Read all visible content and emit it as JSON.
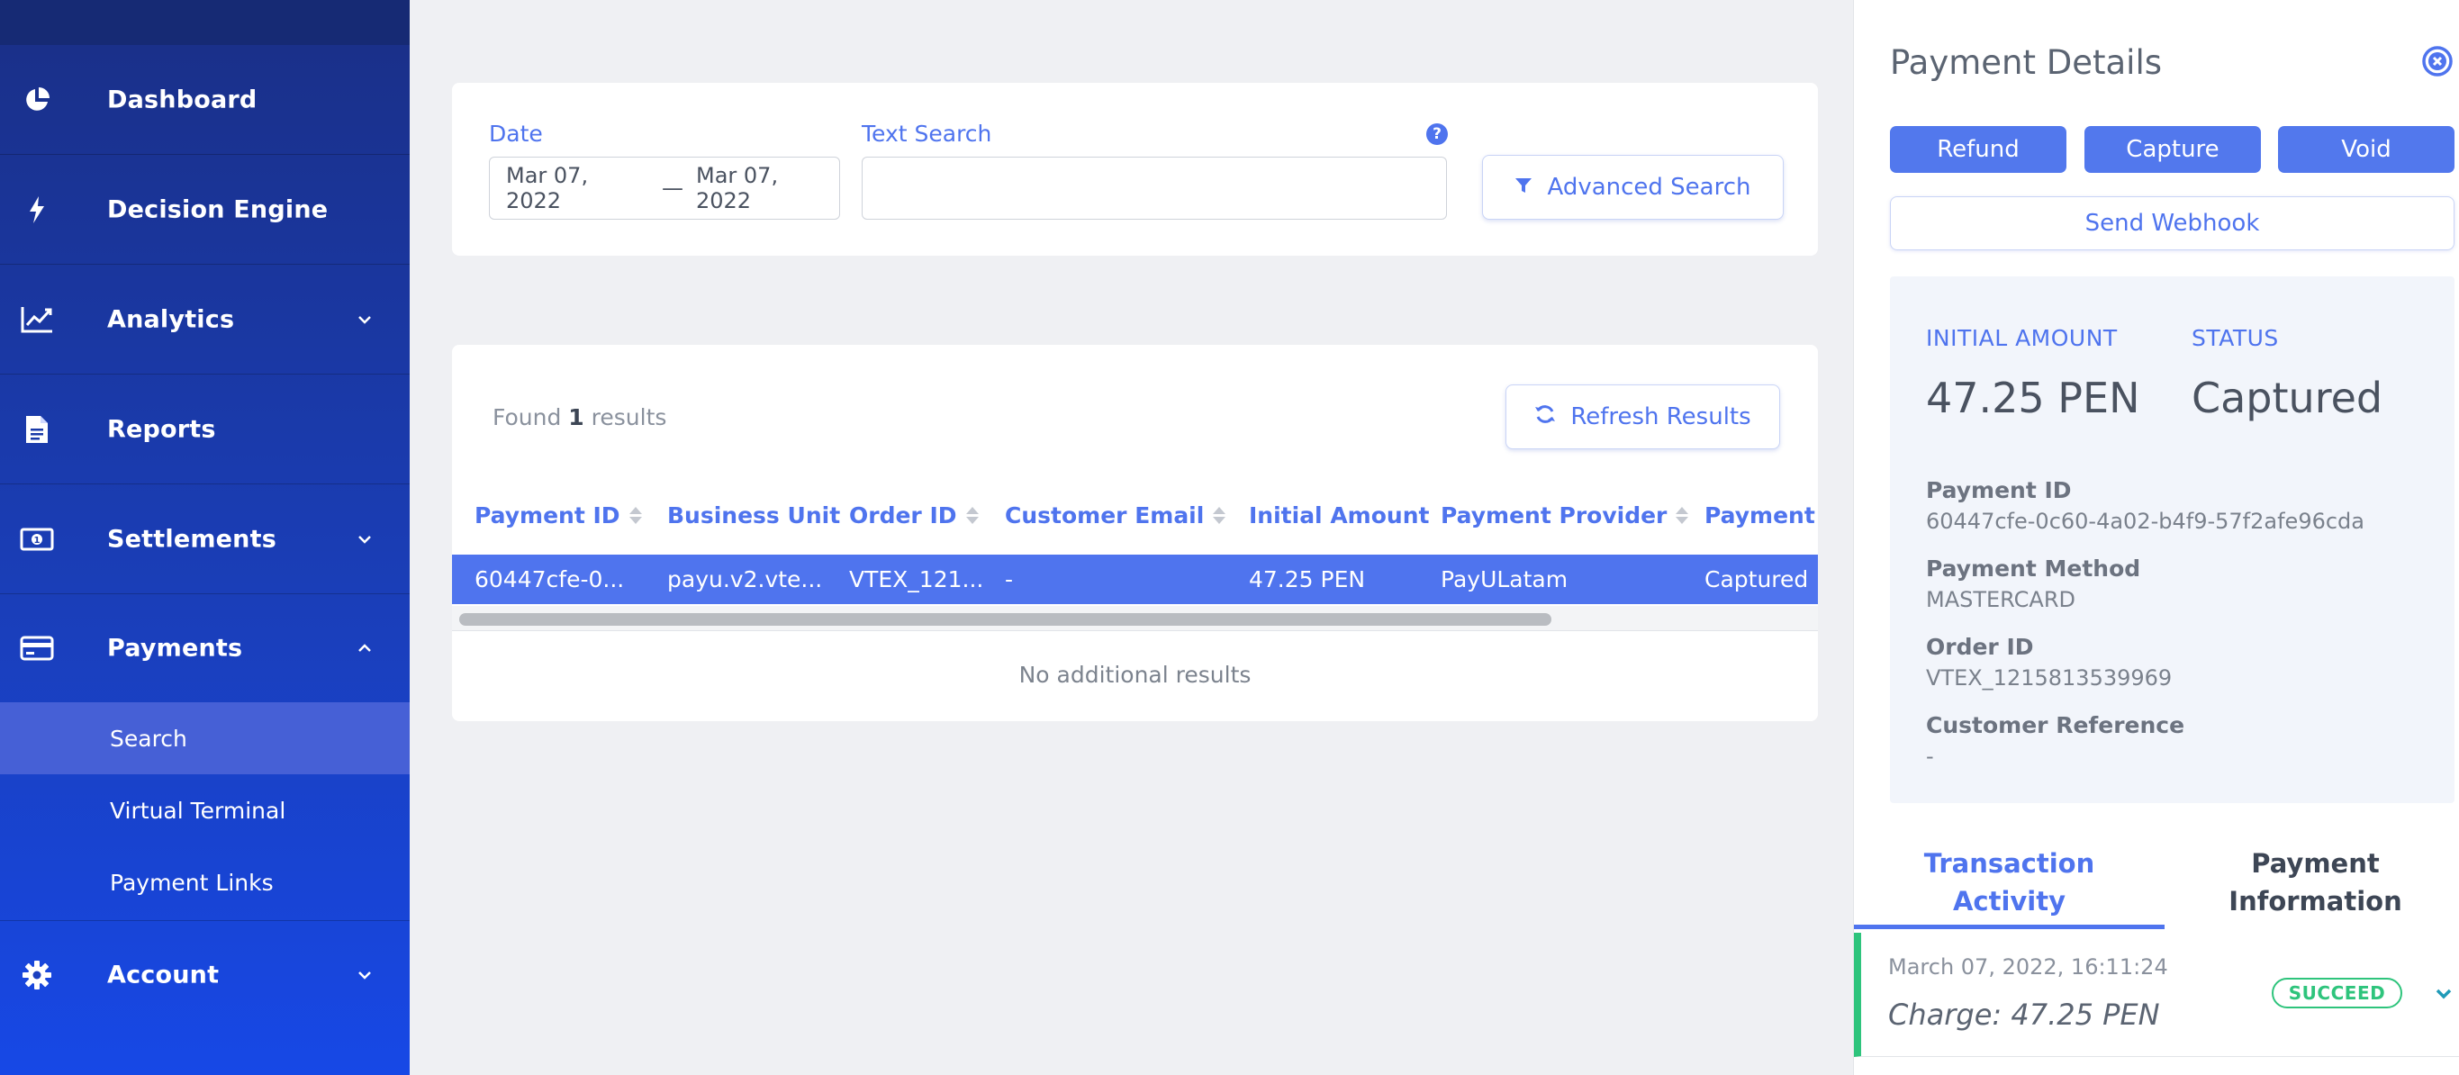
{
  "sidebar": {
    "items": [
      {
        "label": "Dashboard",
        "icon": "pie-chart-icon"
      },
      {
        "label": "Decision Engine",
        "icon": "bolt-icon"
      },
      {
        "label": "Analytics",
        "icon": "line-chart-icon",
        "expandable": true
      },
      {
        "label": "Reports",
        "icon": "document-icon"
      },
      {
        "label": "Settlements",
        "icon": "money-icon",
        "expandable": true
      },
      {
        "label": "Payments",
        "icon": "credit-card-icon",
        "expanded": true
      },
      {
        "label": "Account",
        "icon": "gear-icon",
        "expandable": true
      }
    ],
    "payments_sub": [
      {
        "label": "Search",
        "active": true
      },
      {
        "label": "Virtual Terminal"
      },
      {
        "label": "Payment Links"
      }
    ]
  },
  "filters": {
    "date_label": "Date",
    "date_start": "Mar 07, 2022",
    "date_sep": "—",
    "date_end": "Mar 07, 2022",
    "text_search_label": "Text Search",
    "text_search_value": "",
    "help_icon": "?",
    "advanced_search": "Advanced Search"
  },
  "results": {
    "found_prefix": "Found ",
    "found_count": "1",
    "found_suffix": " results",
    "refresh": "Refresh Results",
    "columns": [
      "Payment ID",
      "Business Unit",
      "Order ID",
      "Customer Email",
      "Initial Amount",
      "Payment Provider",
      "Payment S"
    ],
    "rows": [
      [
        "60447cfe-0...",
        "payu.v2.vte...",
        "VTEX_121...",
        "-",
        "47.25 PEN",
        "PayULatam",
        "Captured"
      ]
    ],
    "no_additional": "No additional results"
  },
  "panel": {
    "title": "Payment Details",
    "refund": "Refund",
    "capture": "Capture",
    "void": "Void",
    "send_webhook": "Send Webhook",
    "initial_amount_label": "INITIAL AMOUNT",
    "initial_amount_value": "47.25 PEN",
    "status_label": "STATUS",
    "status_value": "Captured",
    "details": [
      {
        "label": "Payment ID",
        "value": "60447cfe-0c60-4a02-b4f9-57f2afe96cda"
      },
      {
        "label": "Payment Method",
        "value": "MASTERCARD"
      },
      {
        "label": "Order ID",
        "value": "VTEX_1215813539969"
      },
      {
        "label": "Customer Reference",
        "value": "-"
      }
    ],
    "tab_activity_line1": "Transaction",
    "tab_activity_line2": "Activity",
    "tab_info_line1": "Payment",
    "tab_info_line2": "Information",
    "activity": {
      "timestamp": "March 07, 2022, 16:11:24",
      "charge": "Charge: 47.25 PEN",
      "badge": "SUCCEED"
    }
  },
  "colors": {
    "accent": "#4f74ee",
    "success": "#2ec47c",
    "sidebar_top": "#1a2f86",
    "sidebar_bottom": "#1748e6"
  }
}
